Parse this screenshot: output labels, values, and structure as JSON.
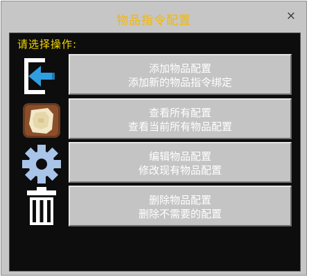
{
  "dialog": {
    "title": "物品指令配置",
    "close_label": "×",
    "prompt": "请选择操作:"
  },
  "options": [
    {
      "icon": "exit-arrow-icon",
      "title": "添加物品配置",
      "subtitle": "添加新的物品指令绑定"
    },
    {
      "icon": "map-scroll-icon",
      "title": "查看所有配置",
      "subtitle": "查看当前所有物品配置"
    },
    {
      "icon": "gear-icon",
      "title": "编辑物品配置",
      "subtitle": "修改现有物品配置"
    },
    {
      "icon": "trash-can-icon",
      "title": "删除物品配置",
      "subtitle": "删除不需要的配置"
    }
  ],
  "colors": {
    "title": "#f5b800",
    "prompt": "#f5d800",
    "panel": "#0d0d0d",
    "button": "#c4c4c4",
    "arrow": "#2f9fe0",
    "gear": "#a8c4e8"
  }
}
